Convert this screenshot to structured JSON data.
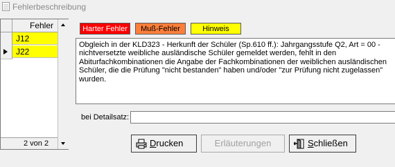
{
  "window": {
    "title": "Fehlerbeschreibung"
  },
  "grid": {
    "header": "Fehler",
    "rows": [
      {
        "value": "J12",
        "current": false
      },
      {
        "value": "J22",
        "current": true
      }
    ],
    "footer": "2 von 2"
  },
  "legend": {
    "error": "Harter Fehler",
    "must": "Muß-Fehler",
    "hint": "Hinweis",
    "colors": {
      "error": "#ff0000",
      "must": "#ff7f3a",
      "hint": "#ffff00"
    }
  },
  "description": "Obgleich in der KLD323 - Herkunft der Schüler (Sp.610 ff.): Jahrgangsstufe Q2, Art = 00 - nichtversetzte weibliche ausländische Schüler gemeldet werden, fehlt in den Abiturfachkombinationen die Angabe der Fachkombinationen der weiblichen ausländischen Schüler, die die Prüfung \"nicht bestanden\" haben und/oder \"zur Prüfung nicht zugelassen\" wurden.",
  "detail": {
    "label": "bei Detailsatz:",
    "value": ""
  },
  "buttons": {
    "print": {
      "first": "D",
      "rest": "rucken"
    },
    "explain": "Erläuterungen",
    "close": {
      "first": "S",
      "rest": "chließen"
    }
  }
}
